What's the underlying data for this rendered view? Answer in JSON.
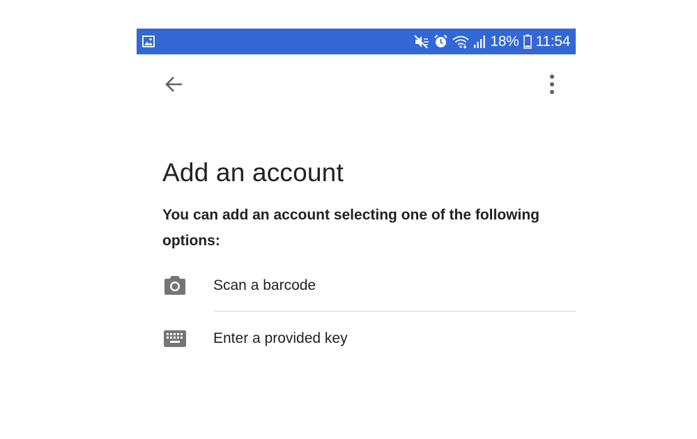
{
  "status_bar": {
    "battery_percent": "18%",
    "time": "11:54",
    "color": "#3367d6",
    "icons": [
      "gallery-icon",
      "mute-icon",
      "alarm-icon",
      "wifi-icon",
      "signal-icon",
      "battery-icon"
    ]
  },
  "app_bar": {
    "back_icon": "arrow-back-icon",
    "menu_icon": "more-vert-icon"
  },
  "main": {
    "title": "Add an account",
    "description": "You can add an account selecting one of the following options:",
    "options": [
      {
        "label": "Scan a barcode",
        "icon": "camera-icon"
      },
      {
        "label": "Enter a provided key",
        "icon": "keyboard-icon"
      }
    ]
  },
  "colors": {
    "text": "#212121",
    "icon": "#757575",
    "divider": "#d5d5d5"
  }
}
